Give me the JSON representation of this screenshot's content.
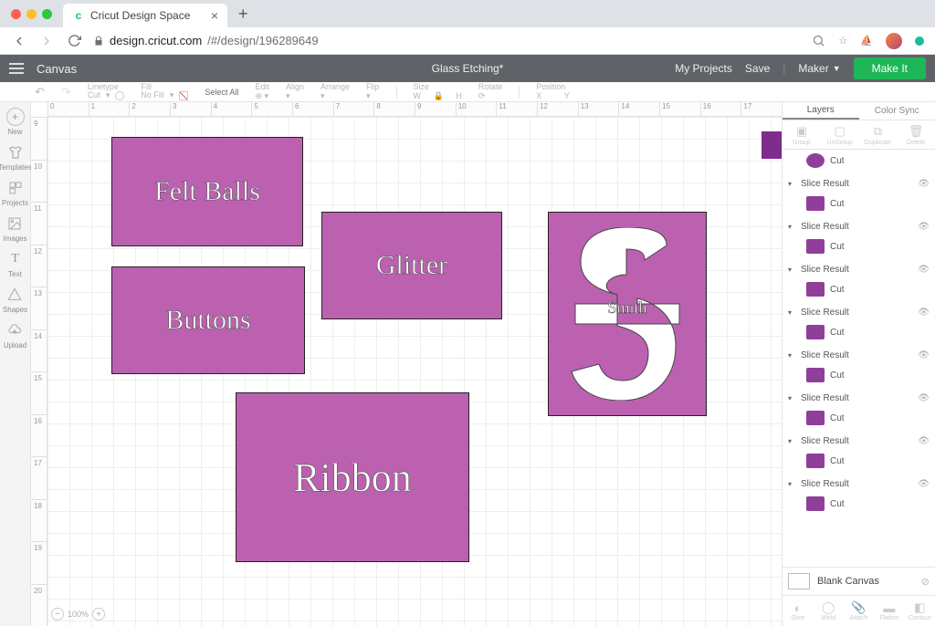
{
  "browser": {
    "tab_title": "Cricut Design Space",
    "url_host": "design.cricut.com",
    "url_path": "/#/design/196289649"
  },
  "app_header": {
    "canvas_label": "Canvas",
    "doc_title": "Glass Etching*",
    "my_projects": "My Projects",
    "save": "Save",
    "machine": "Maker",
    "make_it": "Make It"
  },
  "toolbar": {
    "undo": "↶",
    "redo": "↷",
    "linetype_label": "Linetype",
    "linetype_value": "Cut",
    "fill_label": "Fill",
    "fill_value": "No Fill",
    "select_all": "Select All",
    "edit": "Edit",
    "align": "Align",
    "arrange": "Arrange",
    "flip": "Flip",
    "size": "Size",
    "size_w": "W",
    "size_h": "H",
    "rotate": "Rotate",
    "position": "Position",
    "pos_x": "X",
    "pos_y": "Y"
  },
  "left_rail": {
    "new": "New",
    "templates": "Templates",
    "projects": "Projects",
    "images": "Images",
    "text": "Text",
    "shapes": "Shapes",
    "upload": "Upload"
  },
  "ruler_h": [
    "0",
    "1",
    "2",
    "3",
    "4",
    "5",
    "6",
    "7",
    "8",
    "9",
    "10",
    "11",
    "12",
    "13",
    "14",
    "15",
    "16",
    "17"
  ],
  "ruler_v": [
    "9",
    "10",
    "11",
    "12",
    "13",
    "14",
    "15",
    "16",
    "17",
    "18",
    "19",
    "20"
  ],
  "canvas": {
    "shape1": "Felt Balls",
    "shape2": "Glitter",
    "shape3": "Buttons",
    "shape4": "Ribbon",
    "mono_name": "Smith",
    "zoom": "100%"
  },
  "right_panel": {
    "tab_layers": "Layers",
    "tab_colorsync": "Color Sync",
    "tool_group": "Group",
    "tool_ungroup": "UnGroup",
    "tool_duplicate": "Duplicate",
    "tool_delete": "Delete",
    "cut": "Cut",
    "slice_result": "Slice Result",
    "blank_canvas": "Blank Canvas",
    "btm_slice": "Slice",
    "btm_weld": "Weld",
    "btm_attach": "Attach",
    "btm_flatten": "Flatten",
    "btm_contour": "Contour"
  },
  "colors": {
    "accent": "#bb61b0"
  }
}
